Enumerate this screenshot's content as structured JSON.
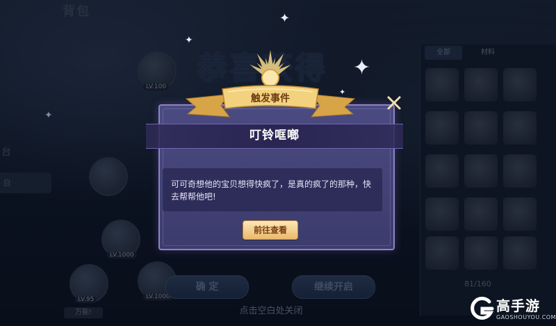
{
  "background": {
    "bag_title": "背包",
    "congrats_title": "恭喜获得",
    "left_tab_label": "台",
    "left_tab_item": "自",
    "left_badge": "万能!",
    "right_tabs": [
      "全部",
      "材料",
      ""
    ],
    "inventory_count": "81/160",
    "item_levels": [
      "LV.100",
      "LV.1000",
      "LV.95",
      "LV.1000"
    ],
    "confirm_button": "确 定",
    "continue_button": "继续开启",
    "close_hint": "点击空白处关闭"
  },
  "dialog": {
    "banner_label": "触发事件",
    "event_title": "叮铃哐啷",
    "event_text": "可可奇想他的宝贝想得快疯了，是真的疯了的那种，快去帮帮他吧!",
    "goto_button": "前往查看"
  },
  "watermark": {
    "brand": "高手游",
    "domain": "GAOSHOUYOU.COM"
  },
  "colors": {
    "dialog_bg": "#4b4b82",
    "dialog_border": "#8f82c5",
    "button_gold": "#e9b96b",
    "ribbon_gold": "#e7b85a"
  }
}
